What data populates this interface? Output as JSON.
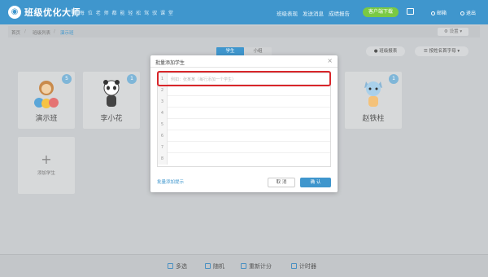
{
  "header": {
    "app_title": "班级优化大师",
    "slogan": "让 每 位 老 师 都 能 轻 松 驾 驭 课 堂",
    "nav": [
      "班级表现",
      "发送消息",
      "成绩报告"
    ],
    "green_button": "客户端下载",
    "links": [
      "邮箱",
      "退出"
    ],
    "logo_glyph": "◉"
  },
  "breadcrumb": {
    "items": [
      "首页",
      "班级列表",
      "演示班"
    ],
    "separator": "/"
  },
  "settings_label": "⚙ 设置 ▾",
  "tabs": [
    "学生",
    "小组"
  ],
  "toolbar": {
    "report_label": "● 班级报表",
    "sort_label": "☰ 按姓名首字母 ▾"
  },
  "cards": [
    {
      "name": "演示班",
      "badge": "5"
    },
    {
      "name": "李小花",
      "badge": "1"
    },
    {
      "name": "赵铁柱",
      "badge": "1"
    }
  ],
  "add_card_label": "添加学生",
  "modal": {
    "title": "批量添加学生",
    "close_glyph": "×",
    "placeholder": "例如：张某某（每行添加一个学生）",
    "line_numbers": [
      "1",
      "2",
      "3",
      "4",
      "5",
      "6",
      "7",
      "8"
    ],
    "hint_link": "批量添加提示",
    "cancel_label": "取 消",
    "ok_label": "确 认"
  },
  "bottom_bar": [
    "多选",
    "随机",
    "重新计分",
    "计时器"
  ],
  "colors": {
    "brand": "#3f96cd",
    "accent_green": "#7ac943",
    "highlight_red": "#d9262a"
  }
}
